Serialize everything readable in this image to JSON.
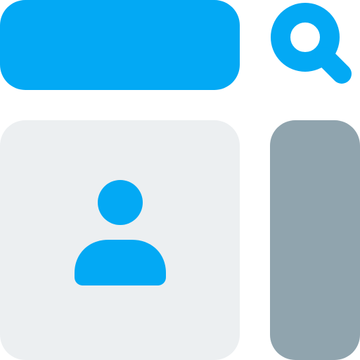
{
  "colors": {
    "accent": "#03A9F4",
    "card_background": "#ECEFF1",
    "side_panel": "#90A4AE",
    "background": "#FFFFFF"
  },
  "icons": {
    "search": "search-icon",
    "user": "user-icon"
  }
}
